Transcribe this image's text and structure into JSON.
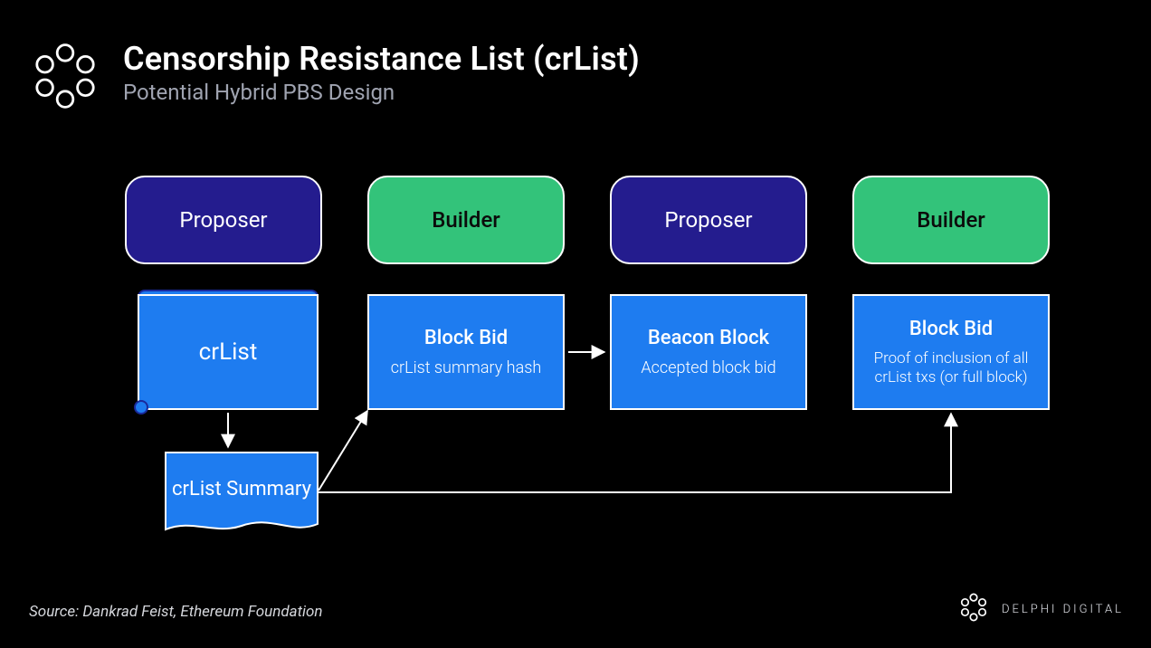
{
  "header": {
    "title": "Censorship Resistance List (crList)",
    "subtitle": "Potential Hybrid PBS Design"
  },
  "roles": {
    "r1": "Proposer",
    "r2": "Builder",
    "r3": "Proposer",
    "r4": "Builder"
  },
  "nodes": {
    "crlist": {
      "title": "crList"
    },
    "block_bid_1": {
      "title": "Block Bid",
      "sub": "crList summary hash"
    },
    "beacon_block": {
      "title": "Beacon Block",
      "sub": "Accepted block bid"
    },
    "block_bid_2": {
      "title": "Block Bid",
      "sub": "Proof of inclusion of all crList txs (or full block)"
    },
    "crlist_summary": {
      "title": "crList Summary"
    }
  },
  "source": "Source: Dankrad Feist, Ethereum Foundation",
  "brand": "DELPHI DIGITAL",
  "colors": {
    "proposer_bg": "#241c8e",
    "builder_bg": "#33c37a",
    "box_bg": "#1e7cf0",
    "stroke": "#ffffff"
  }
}
